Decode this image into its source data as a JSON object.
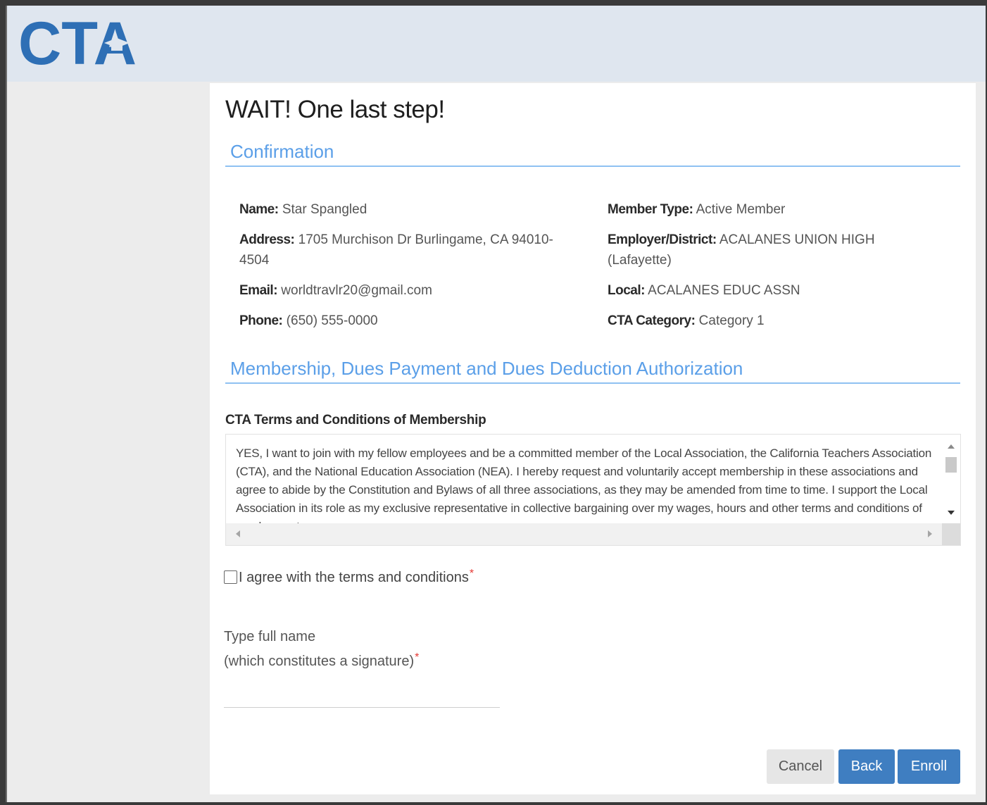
{
  "brand": {
    "logo_text": "CTA",
    "colors": {
      "logo": "#2e6fb5",
      "header": "#dfe6ef",
      "accent": "#5b9fe8",
      "button": "#3f7ec1"
    }
  },
  "page": {
    "title": "WAIT! One last step!"
  },
  "confirmation": {
    "heading": "Confirmation",
    "left": [
      {
        "label": "Name:",
        "value": " Star Spangled"
      },
      {
        "label": "Address:",
        "value": " 1705 Murchison Dr Burlingame, CA 94010-4504"
      },
      {
        "label": "Email:",
        "value": " worldtravlr20@gmail.com"
      },
      {
        "label": "Phone:",
        "value": " (650) 555-0000"
      }
    ],
    "right": [
      {
        "label": "Member Type:",
        "value": " Active Member"
      },
      {
        "label": "Employer/District:",
        "value": " ACALANES UNION HIGH (Lafayette)"
      },
      {
        "label": "Local:",
        "value": " ACALANES EDUC ASSN"
      },
      {
        "label": "CTA Category:",
        "value": " Category 1"
      }
    ]
  },
  "membership": {
    "heading": "Membership, Dues Payment and Dues Deduction Authorization",
    "terms_heading": "CTA Terms and Conditions of Membership",
    "terms_text": "YES, I want to join with my fellow employees and be a committed member of the Local Association, the California Teachers Association (CTA), and the National Education Association (NEA). I hereby request and voluntarily accept membership in these associations and agree to abide by the Constitution and Bylaws of all three associations, as they may be amended from time to time. I support the Local Association in its role as my exclusive representative in collective bargaining over my wages, hours and other terms and conditions of employment."
  },
  "agreement": {
    "label": "I agree with the terms and conditions",
    "required_mark": "*"
  },
  "signature": {
    "label_line1": "Type full name",
    "label_line2": "(which constitutes a signature)",
    "required_mark": "*",
    "value": ""
  },
  "buttons": {
    "cancel": "Cancel",
    "back": "Back",
    "enroll": "Enroll"
  }
}
